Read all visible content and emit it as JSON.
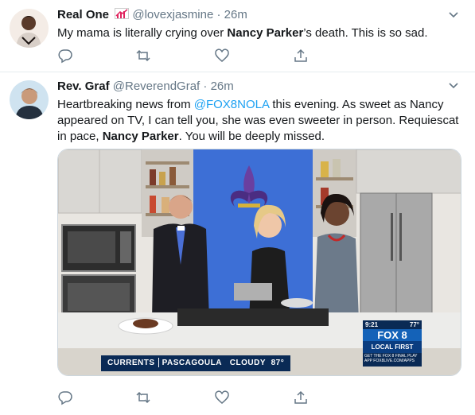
{
  "tweets": [
    {
      "name": "Real One",
      "name_emoji": "chart-increasing-emoji",
      "handle": "@lovexjasmine",
      "separator": "·",
      "time": "26m",
      "text_before": "My mama is literally crying over ",
      "text_bold": "Nancy Parker",
      "text_after": "’s death. This is so sad.",
      "avatar_icon": "user-avatar"
    },
    {
      "name": "Rev. Graf",
      "handle": "@ReverendGraf",
      "separator": "·",
      "time": "26m",
      "text_before": "Heartbreaking news from ",
      "text_mention": "@FOX8NOLA",
      "text_middle": " this evening. As sweet as Nancy appeared on TV, I can tell you, she was even sweeter in person.  Requiescat in pace, ",
      "text_bold": "Nancy Parker",
      "text_after": ". You will be deeply missed.",
      "avatar_icon": "user-avatar",
      "media": {
        "lower_third_left": "CURRENTS",
        "lower_third_location": "PASCAGOULA",
        "lower_third_weather": "CLOUDY",
        "lower_third_temp": "87°",
        "bug_time": "9:21",
        "bug_temp": "77°",
        "bug_logo": "FOX 8",
        "bug_tagline": "LOCAL FIRST",
        "bug_bottom": "GET THE FOX 8 FINAL PLAY APP FOX8LIVE.COM/APPS"
      }
    }
  ],
  "actions": [
    "reply-icon",
    "retweet-icon",
    "like-icon",
    "share-icon"
  ],
  "colors": {
    "link": "#1da1f2",
    "secondary_text": "#657786",
    "icon": "#657786",
    "divider": "#e6ecf0",
    "kitchen_wall": "#3d6fd6",
    "fox_blue": "#0a2a55"
  }
}
